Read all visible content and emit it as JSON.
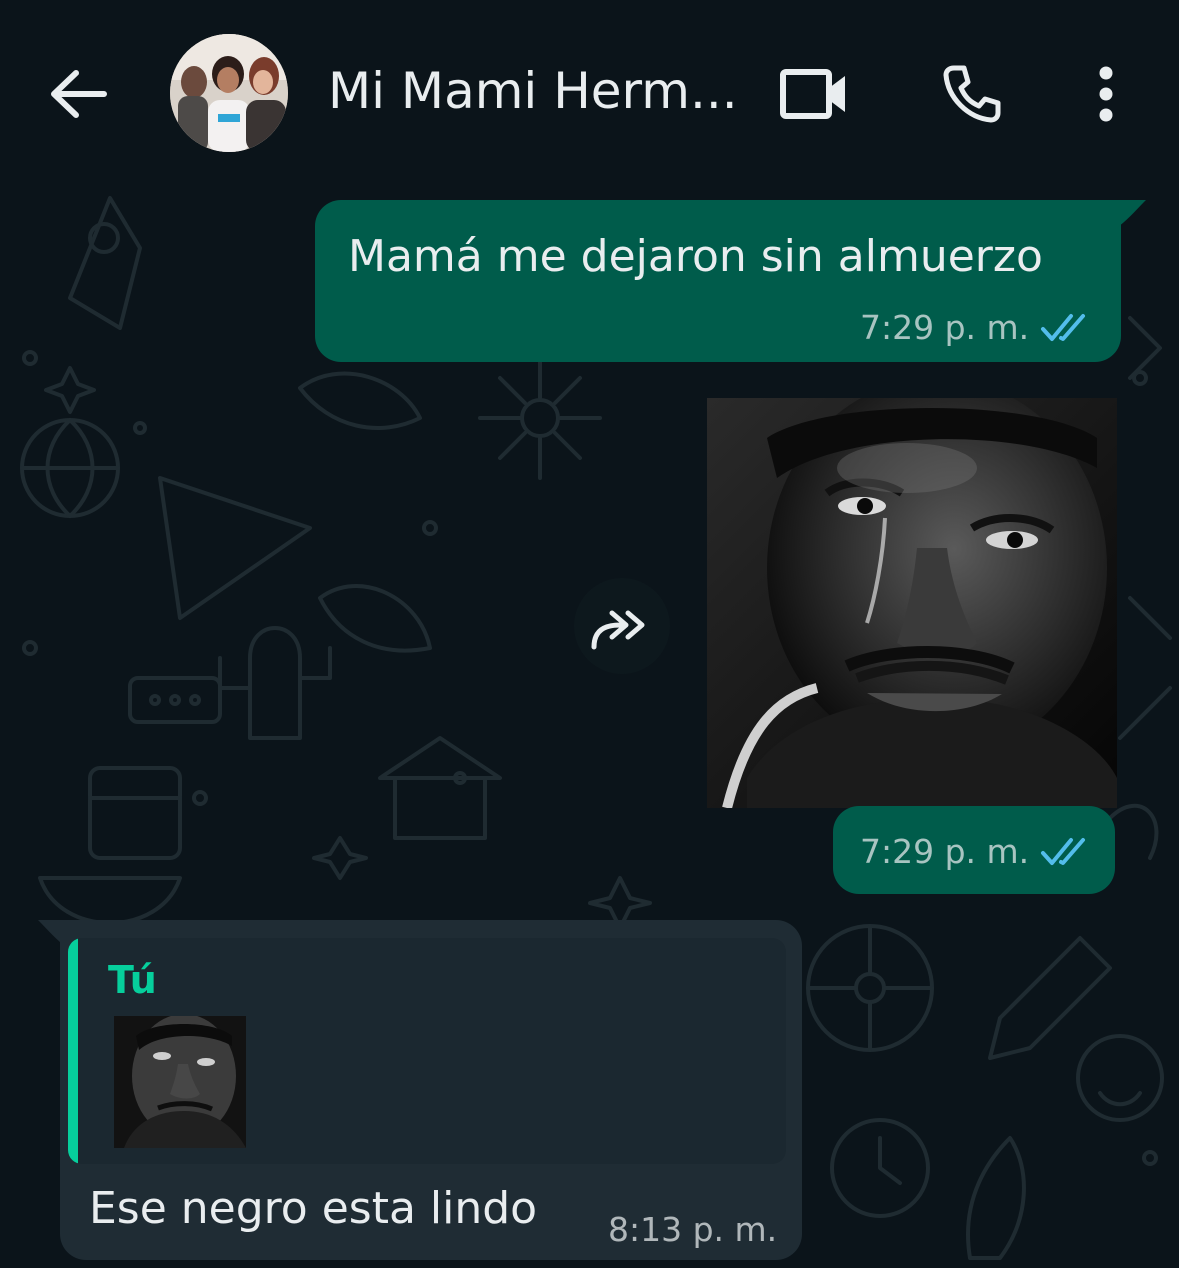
{
  "header": {
    "contact_name": "Mi Mami Herm...",
    "icons": {
      "back": "arrow-back-icon",
      "video": "video-call-icon",
      "call": "phone-icon",
      "menu": "more-vert-icon"
    }
  },
  "messages": [
    {
      "direction": "outgoing",
      "type": "text",
      "text": "Mamá me dejaron sin almuerzo",
      "time": "7:29 p. m.",
      "status": "read"
    },
    {
      "direction": "outgoing",
      "type": "image",
      "image_description": "black-and-white portrait of a crying man",
      "time": "7:29 p. m.",
      "status": "read"
    },
    {
      "direction": "incoming",
      "type": "reply",
      "quote": {
        "author": "Tú",
        "type": "image"
      },
      "text": "Ese negro esta lindo",
      "time": "8:13 p. m."
    }
  ],
  "colors": {
    "background": "#0b141a",
    "outgoing_bubble": "#005c4b",
    "incoming_bubble": "#1f2c34",
    "quote_accent": "#06cf9c",
    "read_ticks": "#53bdeb"
  }
}
